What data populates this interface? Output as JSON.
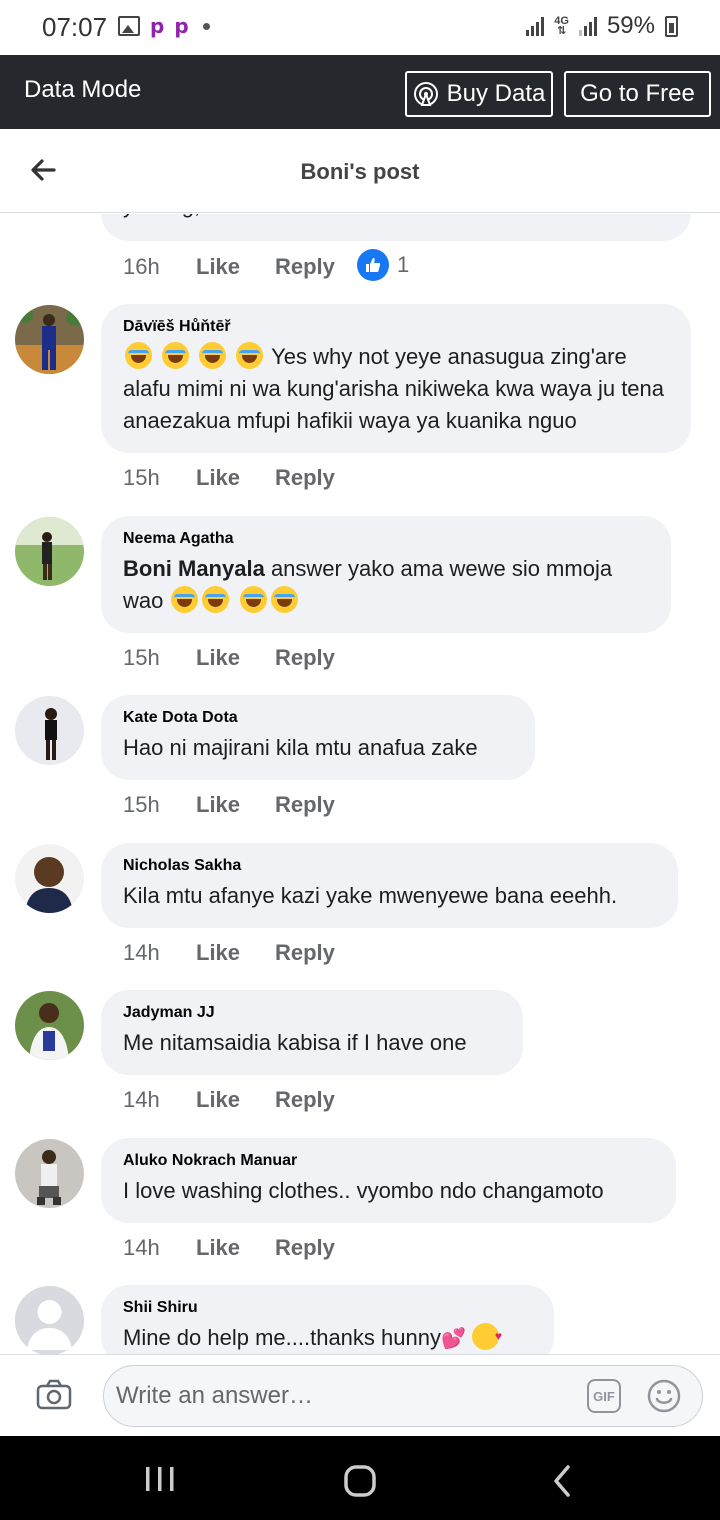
{
  "status_bar": {
    "time": "07:07",
    "network": "4G",
    "battery": "59%"
  },
  "data_mode": {
    "label": "Data Mode",
    "buy_data": "Buy Data",
    "go_free": "Go to Free"
  },
  "header": {
    "title": "Boni's post"
  },
  "partial_comment": {
    "text": "you big,it means alot",
    "time": "16h",
    "like": "Like",
    "reply": "Reply",
    "reaction_count": "1"
  },
  "comments": [
    {
      "author": "Dāvïēš Hůňtēř",
      "text": "Yes why not yeye anasugua zing'are alafu mimi ni wa kung'arisha nikiweka kwa waya ju tena anaezakua mfupi hafikii waya ya kuanika nguo",
      "time": "15h",
      "like": "Like",
      "reply": "Reply"
    },
    {
      "author": "Neema Agatha",
      "mention": "Boni Manyala",
      "text": "answer yako ama wewe sio mmoja wao",
      "time": "15h",
      "like": "Like",
      "reply": "Reply"
    },
    {
      "author": "Kate Dota Dota",
      "text": "Hao ni majirani kila mtu anafua zake",
      "time": "15h",
      "like": "Like",
      "reply": "Reply"
    },
    {
      "author": "Nicholas Sakha",
      "text": "Kila mtu afanye kazi yake mwenyewe bana eeehh.",
      "time": "14h",
      "like": "Like",
      "reply": "Reply"
    },
    {
      "author": "Jadyman JJ",
      "text": "Me nitamsaidia kabisa if I have one",
      "time": "14h",
      "like": "Like",
      "reply": "Reply"
    },
    {
      "author": "Aluko Nokrach Manuar",
      "text": "I love washing clothes.. vyombo ndo changamoto",
      "time": "14h",
      "like": "Like",
      "reply": "Reply"
    },
    {
      "author": "Shii Shiru",
      "text": "Mine do help me....thanks hunny",
      "time": "",
      "like": "",
      "reply": ""
    }
  ],
  "composer": {
    "placeholder": "Write an answer…",
    "gif_label": "GIF"
  },
  "colors": {
    "facebook_blue": "#1877f2",
    "bubble_bg": "#f0f2f5",
    "data_mode_bar": "#25282d"
  }
}
